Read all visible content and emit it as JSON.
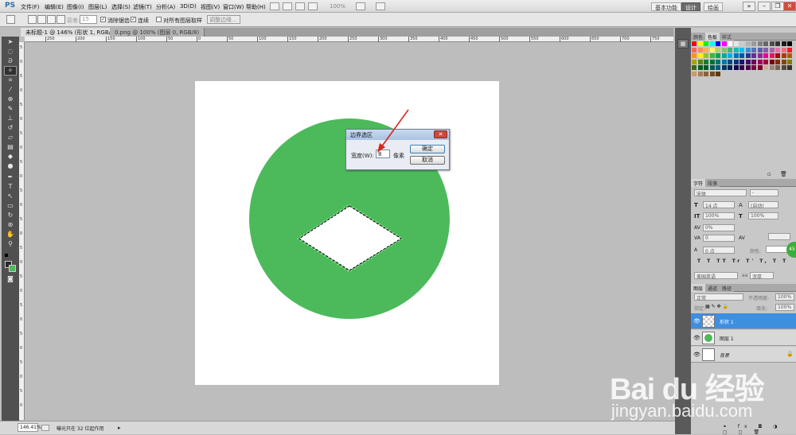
{
  "app": {
    "logo": "PS",
    "menu": [
      "文件(F)",
      "编辑(E)",
      "图像(I)",
      "图层(L)",
      "选择(S)",
      "滤镜(T)",
      "分析(A)",
      "3D(D)",
      "视图(V)",
      "窗口(W)",
      "帮助(H)"
    ],
    "zoom_display": "100%",
    "workspaces": [
      "基本功能",
      "设计",
      "绘画"
    ]
  },
  "options": {
    "tolerance_label": "容差:",
    "tolerance_value": "15",
    "antialias_label": "消除锯齿",
    "contiguous_label": "连续",
    "all_layers_label": "对所有图层取样",
    "refine_edge_label": "调整边缘..."
  },
  "tabs": [
    {
      "label": "未标题-1 @ 146% (形状 1, RGB/8) *",
      "active": true
    },
    {
      "label": "0.png @ 100% (图层 0, RGB/8)",
      "active": false
    }
  ],
  "ruler_top": [
    "250",
    "200",
    "150",
    "100",
    "50",
    "0",
    "50",
    "100",
    "150",
    "200",
    "250",
    "300",
    "350",
    "400",
    "450",
    "500",
    "550",
    "600",
    "650",
    "700",
    "750"
  ],
  "ruler_left": [
    "5",
    "0",
    "5",
    "0",
    "5",
    "0",
    "5",
    "0",
    "5",
    "0",
    "5",
    "0",
    "5",
    "0",
    "5",
    "0",
    "5",
    "0",
    "5",
    "0",
    "5",
    "0",
    "5",
    "0",
    "5",
    "0"
  ],
  "dialog": {
    "title": "边界选区",
    "width_label": "宽度(W):",
    "width_value": "8",
    "unit": "像素",
    "ok_label": "确定",
    "cancel_label": "取消",
    "close_symbol": "✕"
  },
  "status": {
    "zoom": "146.41%",
    "text": "曝光只在 32 位起作用"
  },
  "panels": {
    "swatch_tabs": [
      "颜色",
      "色板",
      "样式"
    ],
    "char_tabs": [
      "字符",
      "段落"
    ],
    "font_family": "宋体",
    "font_style": "-",
    "font_size": "14 点",
    "leading": "(自动)",
    "vscale": "100%",
    "hscale": "100%",
    "tracking": "0%",
    "kerning": "0",
    "baseline": "0 点",
    "color_label": "颜色:",
    "language": "美国英语",
    "aa_label": "aa",
    "aa_value": "浑厚",
    "type_buttons": [
      "T",
      "T",
      "TT",
      "Tr",
      "T'",
      "T,",
      "T",
      "T"
    ],
    "layer_tabs": [
      "图层",
      "通道",
      "路径"
    ],
    "blend_mode": "正常",
    "opacity_label": "不透明度:",
    "opacity_value": "100%",
    "lock_label": "锁定:",
    "fill_label": "填充:",
    "fill_value": "100%",
    "layers": [
      {
        "name": "形状 1",
        "selected": true,
        "thumb": "checker"
      },
      {
        "name": "图层 1",
        "selected": false,
        "thumb": "green"
      },
      {
        "name": "背景",
        "selected": false,
        "thumb": "white"
      }
    ],
    "bottom_icons": [
      "⚭",
      "fx",
      "◘",
      "◑",
      "▢",
      "◻",
      "🗑"
    ]
  },
  "colors": {
    "circle": "#4cba5a",
    "arrow": "#d9261c",
    "selected_layer": "#3d8fe0",
    "fg_color": "#2a2a2a",
    "bg_color": "#4cba5a"
  },
  "watermark": {
    "line1": "Bai du 经验",
    "line2": "jingyan.baidu.com"
  },
  "badge": "45"
}
